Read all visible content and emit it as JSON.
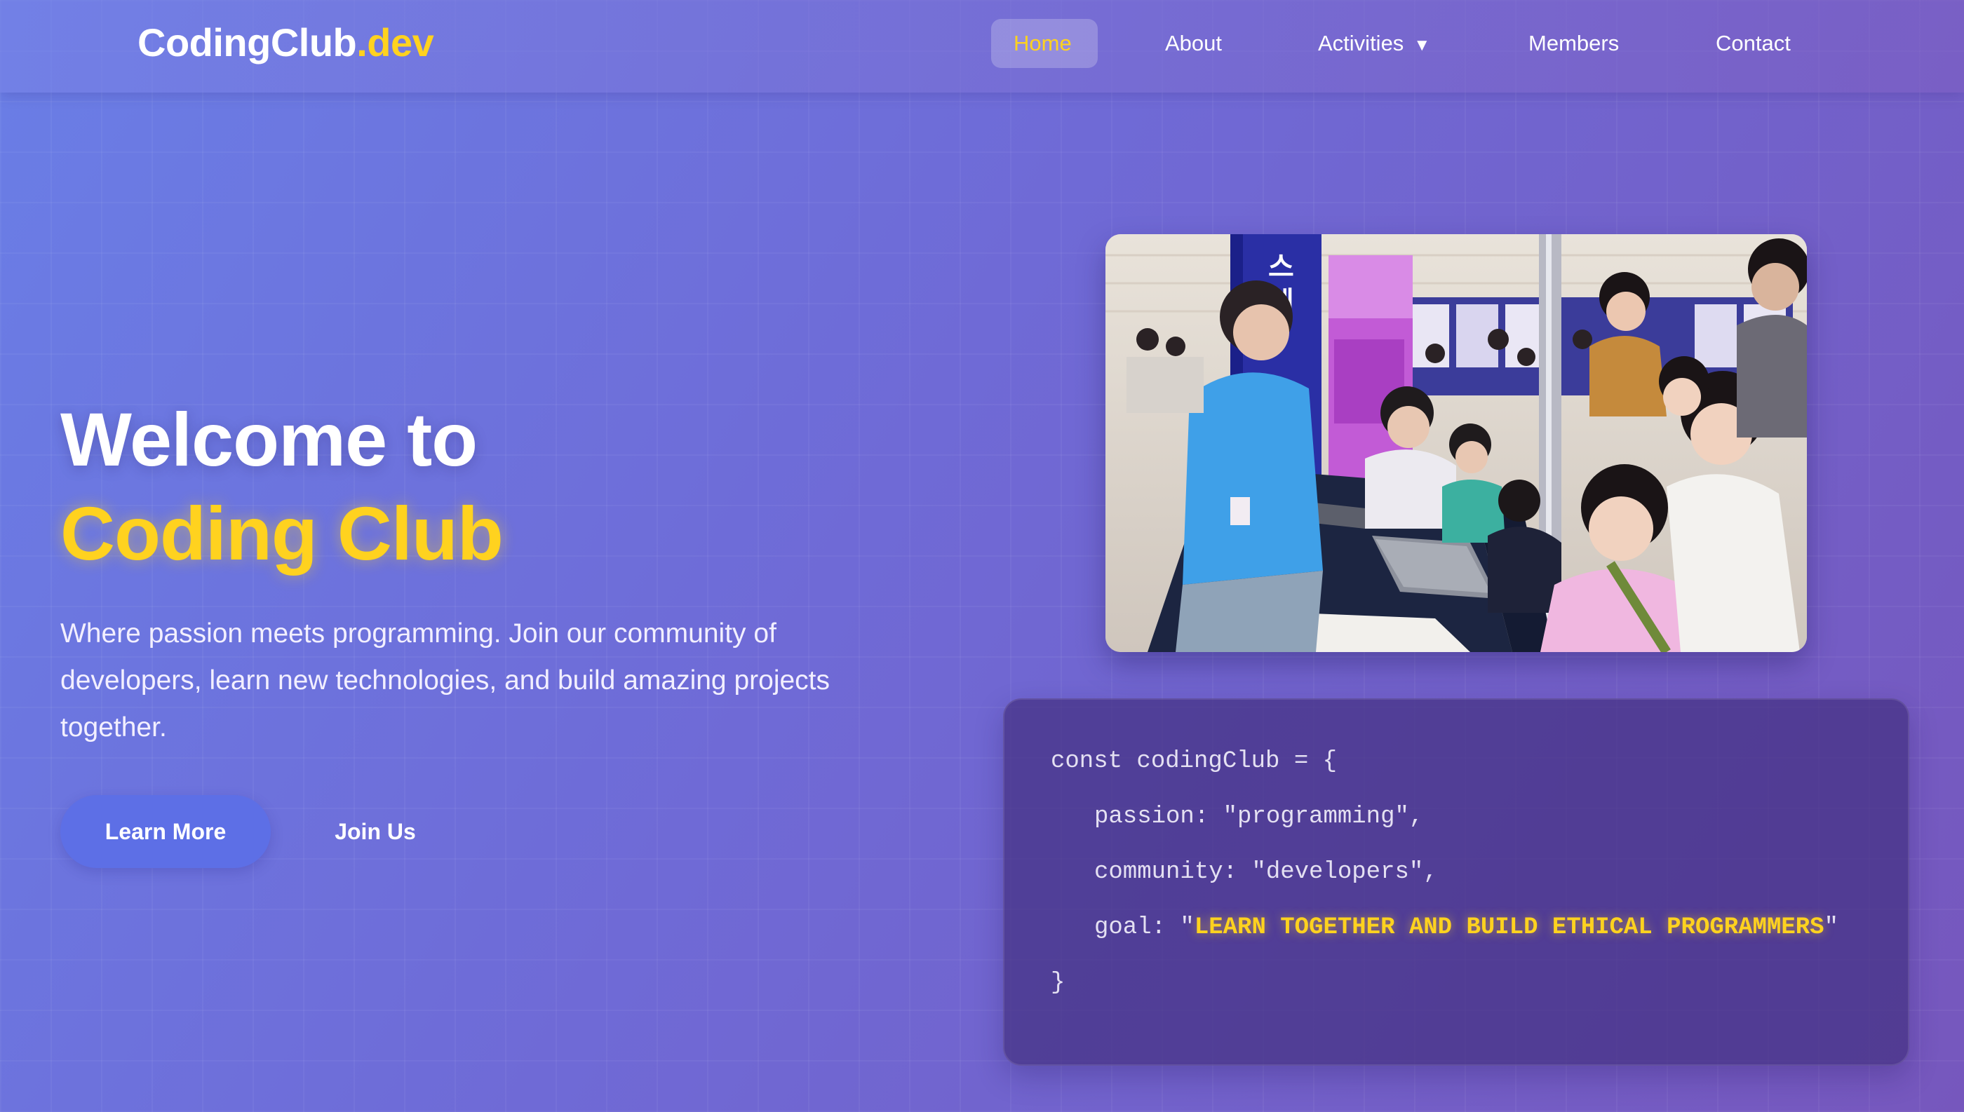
{
  "brand": {
    "name": "CodingClub",
    "tld": ".dev",
    "accent_color": "#ffd21f"
  },
  "nav": {
    "home": "Home",
    "about": "About",
    "activities": "Activities",
    "activities_caret": "▼",
    "members": "Members",
    "contact": "Contact"
  },
  "hero": {
    "title_line1": "Welcome to",
    "title_line2": "Coding Club",
    "description": "Where passion meets programming. Join our community of developers, learn new technologies, and build amazing projects together.",
    "primary_button": "Learn More",
    "secondary_button": "Join Us"
  },
  "photo": {
    "semantic": "club-event-photo"
  },
  "code": {
    "line1": "const codingClub = {",
    "line2_key": "passion: ",
    "line2_value": "\"programming\",",
    "line3_key": "community: ",
    "line3_value": "\"developers\",",
    "line4_key": "goal: ",
    "line4_quote_open": "\"",
    "line4_value": "LEARN TOGETHER AND BUILD ETHICAL PROGRAMMERS",
    "line4_quote_close": "\"",
    "line5": "}"
  },
  "colors": {
    "background_start": "#6a7ee6",
    "background_end": "#7657bd",
    "primary_button": "#5d6fe6",
    "highlight": "#ffd21f"
  }
}
